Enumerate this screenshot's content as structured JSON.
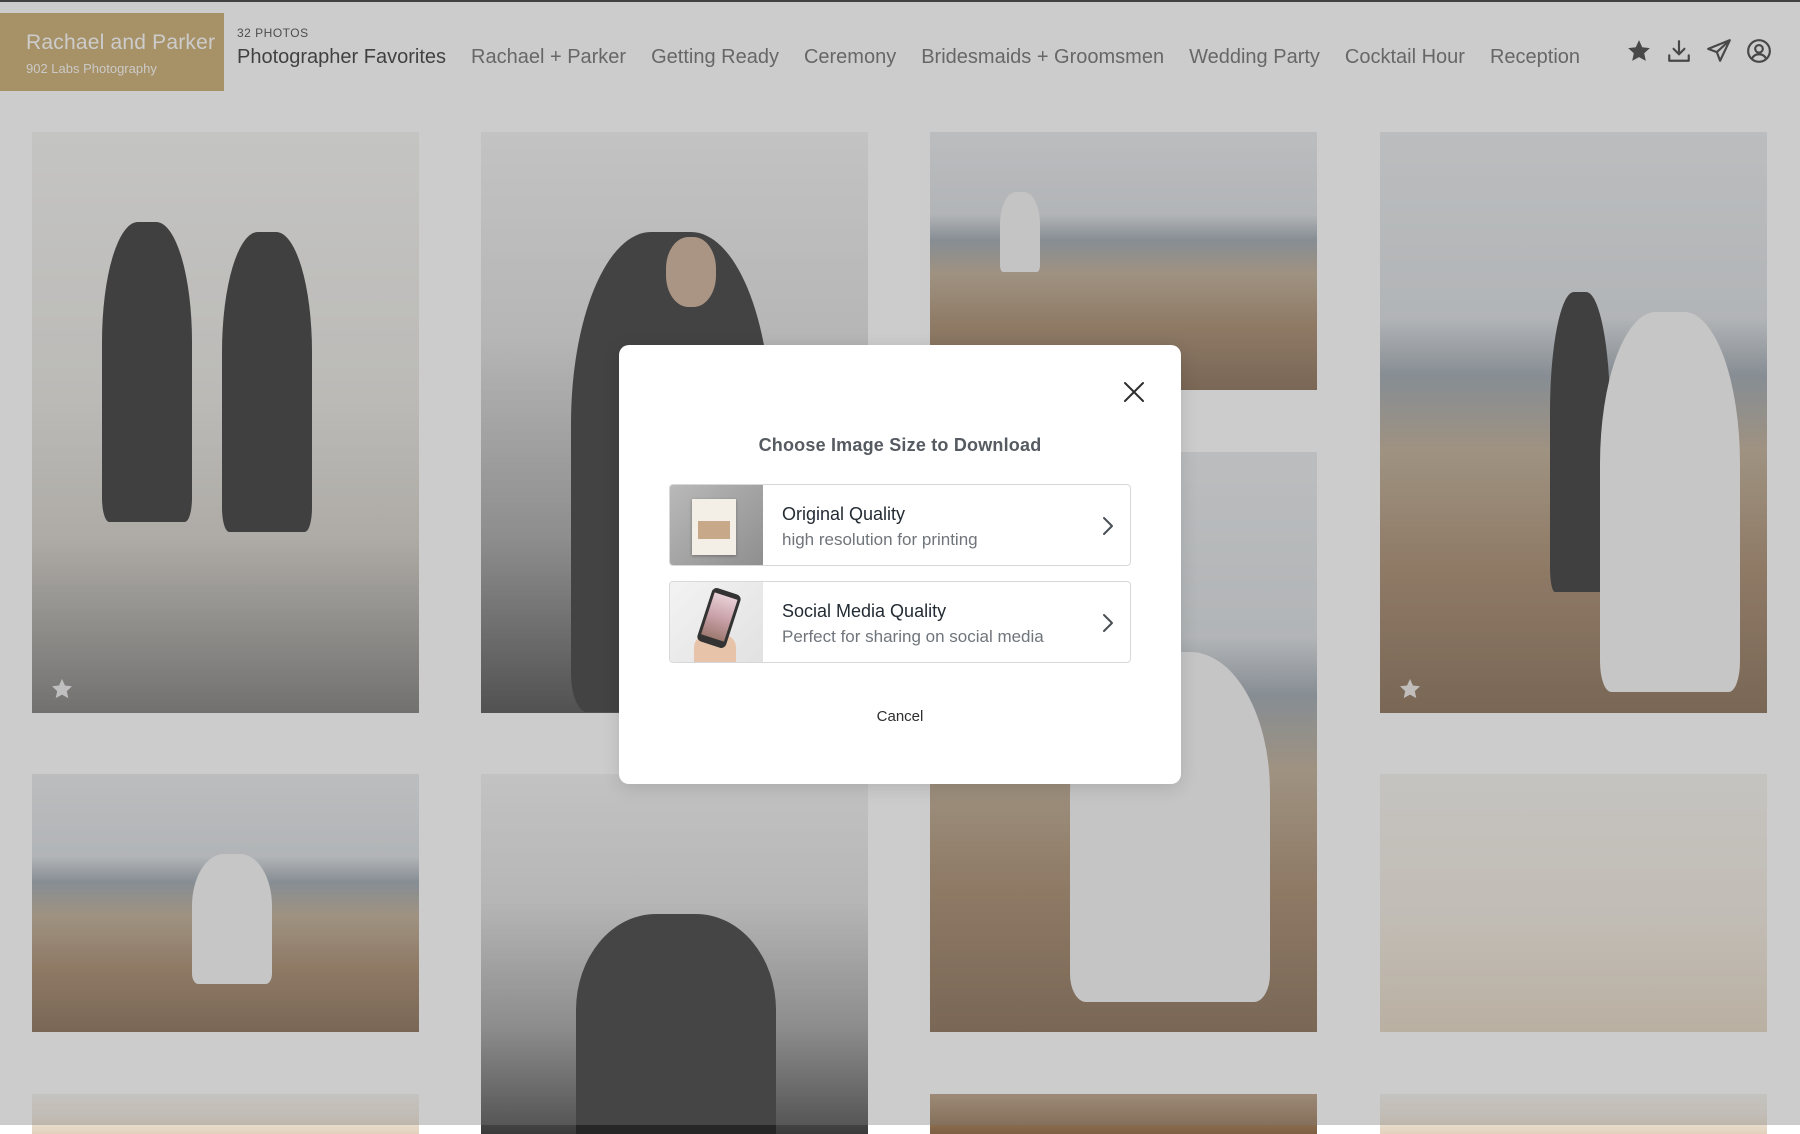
{
  "brand": {
    "title": "Rachael and Parker",
    "subtitle": "902 Labs Photography",
    "color": "#c4a05b"
  },
  "gallery_meta": {
    "photo_count": "32 PHOTOS"
  },
  "nav": {
    "items": [
      {
        "label": "Photographer Favorites",
        "active": true
      },
      {
        "label": "Rachael + Parker"
      },
      {
        "label": "Getting Ready"
      },
      {
        "label": "Ceremony"
      },
      {
        "label": "Bridesmaids + Groomsmen"
      },
      {
        "label": "Wedding Party"
      },
      {
        "label": "Cocktail Hour"
      },
      {
        "label": "Reception"
      }
    ]
  },
  "header_icons": [
    "star-icon",
    "download-icon",
    "send-icon",
    "account-icon"
  ],
  "modal": {
    "title": "Choose Image Size to Download",
    "options": [
      {
        "title": "Original Quality",
        "subtitle": "high resolution for printing",
        "thumb": "print-thumbnail"
      },
      {
        "title": "Social Media Quality",
        "subtitle": "Perfect for sharing on social media",
        "thumb": "phone-thumbnail"
      }
    ],
    "cancel_label": "Cancel"
  }
}
